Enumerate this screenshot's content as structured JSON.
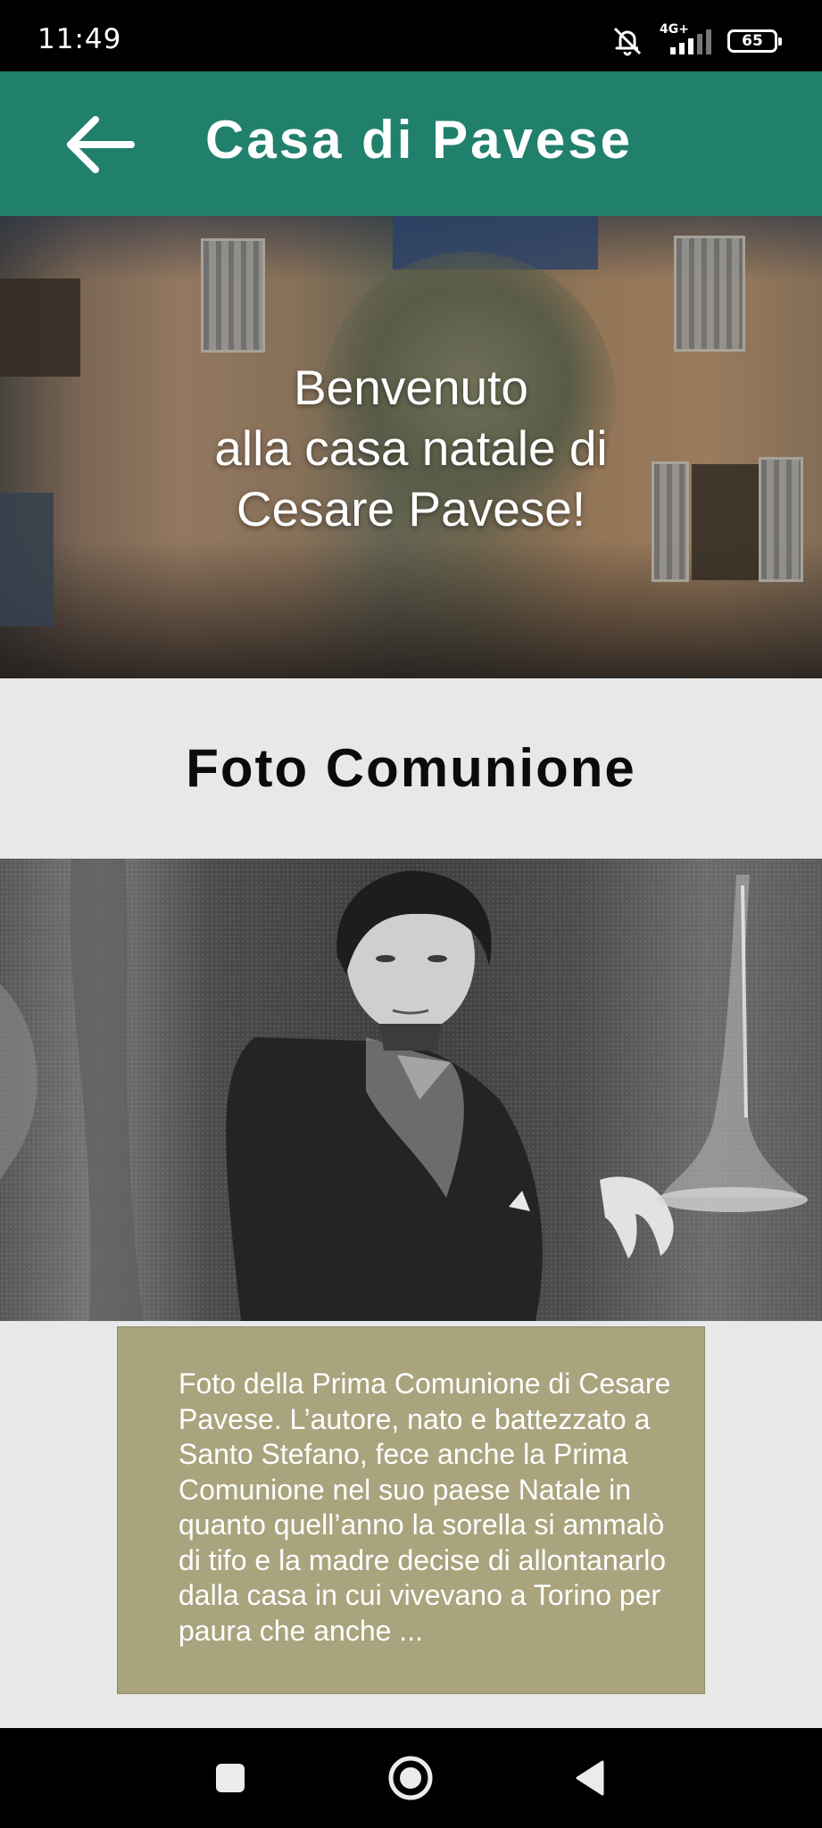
{
  "status_bar": {
    "time": "11:49",
    "network_label": "4G+",
    "battery_level": "65",
    "icons": [
      "bell-off-icon",
      "signal-icon",
      "battery-icon"
    ]
  },
  "app_bar": {
    "title": "Casa di Pavese",
    "background_color": "#21806b",
    "back_icon": "arrow-left-icon"
  },
  "hero": {
    "welcome_text": "Benvenuto\nalla casa natale di\nCesare Pavese!",
    "image_description_icon": "house-photo"
  },
  "section": {
    "title": "Foto Comunione"
  },
  "photo": {
    "icon": "communion-photo"
  },
  "caption": {
    "text": "Foto della Prima Comunione di Cesare Pavese. L’autore, nato e battezzato a Santo Stefano, fece anche la Prima Comunione nel suo paese Natale in quanto quell’anno la sorella si ammalò di tifo e la madre decise di allontanarlo dalla casa in cui vivevano a Torino per paura che anche ..."
  },
  "nav_bar": {
    "icons": [
      "recents-icon",
      "home-icon",
      "back-icon"
    ]
  }
}
